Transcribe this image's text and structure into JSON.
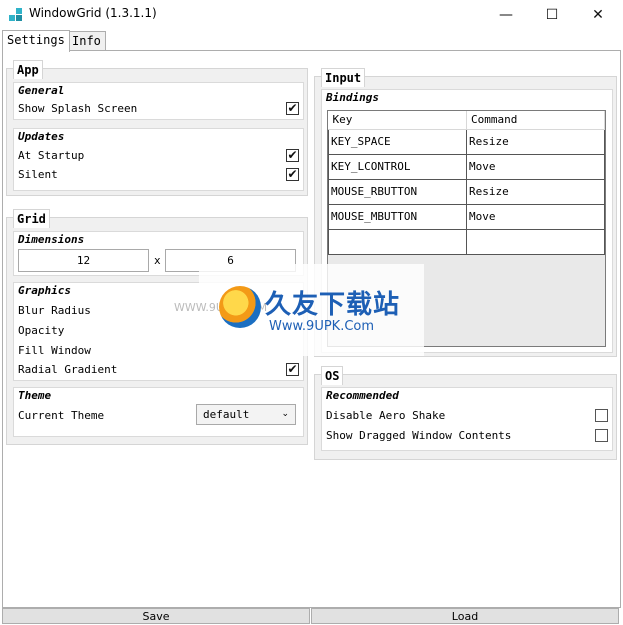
{
  "window": {
    "title": "WindowGrid (1.3.1.1)",
    "minimize": "—",
    "maximize": "☐",
    "close": "✕"
  },
  "tabs": [
    {
      "label": "Settings"
    },
    {
      "label": "Info"
    }
  ],
  "app": {
    "title": "App",
    "general": {
      "title": "General",
      "show_splash_label": "Show Splash Screen",
      "show_splash_checked": "✔"
    },
    "updates": {
      "title": "Updates",
      "at_startup_label": "At Startup",
      "at_startup_checked": "✔",
      "silent_label": "Silent",
      "silent_checked": "✔"
    }
  },
  "grid": {
    "title": "Grid",
    "dimensions": {
      "title": "Dimensions",
      "width": "12",
      "separator": "x",
      "height": "6"
    },
    "graphics": {
      "title": "Graphics",
      "blur_radius_label": "Blur Radius",
      "opacity_label": "Opacity",
      "fill_window_label": "Fill Window",
      "radial_gradient_label": "Radial Gradient",
      "radial_gradient_checked": "✔"
    },
    "theme": {
      "title": "Theme",
      "current_theme_label": "Current Theme",
      "current_theme_value": "default"
    }
  },
  "input": {
    "title": "Input",
    "bindings": {
      "title": "Bindings",
      "columns": [
        "Key",
        "Command"
      ],
      "rows": [
        {
          "key": "KEY_SPACE",
          "command": "Resize"
        },
        {
          "key": "KEY_LCONTROL",
          "command": "Move"
        },
        {
          "key": "MOUSE_RBUTTON",
          "command": "Resize"
        },
        {
          "key": "MOUSE_MBUTTON",
          "command": "Move"
        },
        {
          "key": "",
          "command": ""
        }
      ]
    }
  },
  "os": {
    "title": "OS",
    "recommended": {
      "title": "Recommended",
      "disable_aero_shake_label": "Disable Aero Shake",
      "show_dragged_label": "Show Dragged Window Contents"
    }
  },
  "buttons": {
    "save": "Save",
    "load": "Load"
  },
  "watermark": {
    "brand": "久友下载站",
    "url": "Www.9UPK.Com",
    "small": "WWW.9UPK.COM"
  },
  "colors": {
    "accent_icon": "#2fb3c9",
    "panel_bg": "#f0f0f0",
    "watermark_blue": "#1d5fb5"
  }
}
